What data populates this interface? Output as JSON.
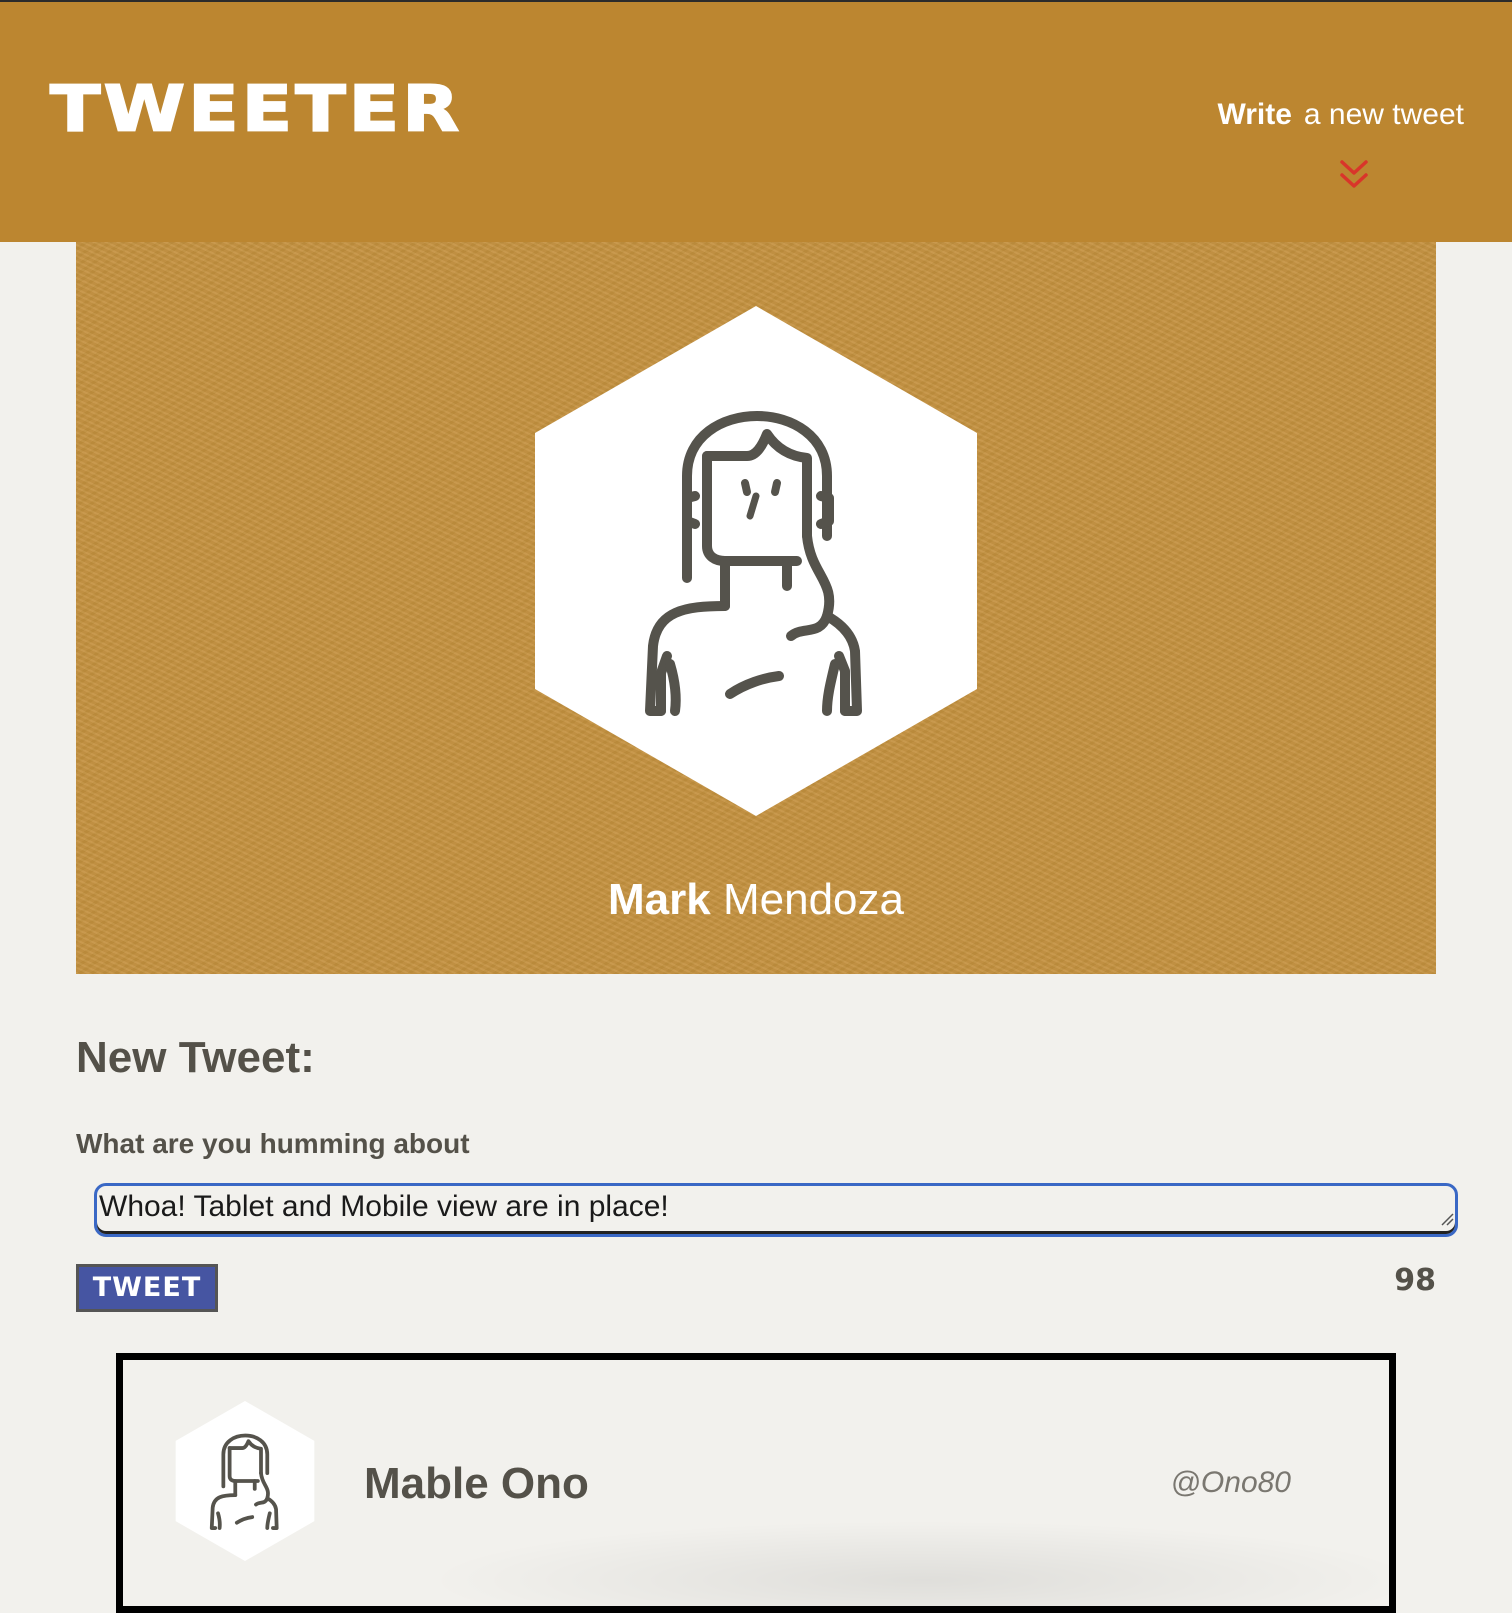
{
  "header": {
    "brand": "TWEETER",
    "write_strong": "Write",
    "write_rest": "a new tweet"
  },
  "profile": {
    "first_name": "Mark",
    "last_name": "Mendoza",
    "avatar_icon": "person-avatar-icon"
  },
  "compose": {
    "title": "New Tweet:",
    "label": "What are you humming about",
    "value": "Whoa! Tablet and Mobile view are in place!",
    "button_label": "TWEET",
    "counter": "98"
  },
  "tweets": [
    {
      "name": "Mable Ono",
      "handle": "@Ono80",
      "avatar_icon": "person-avatar-icon"
    }
  ],
  "colors": {
    "header_bg": "#bc8630",
    "profile_bg": "#c4913e",
    "page_bg": "#f2f1ed",
    "text": "#545149",
    "button_bg": "#4655a2",
    "chevron": "#d9352a",
    "input_focus": "#3a68c5"
  }
}
